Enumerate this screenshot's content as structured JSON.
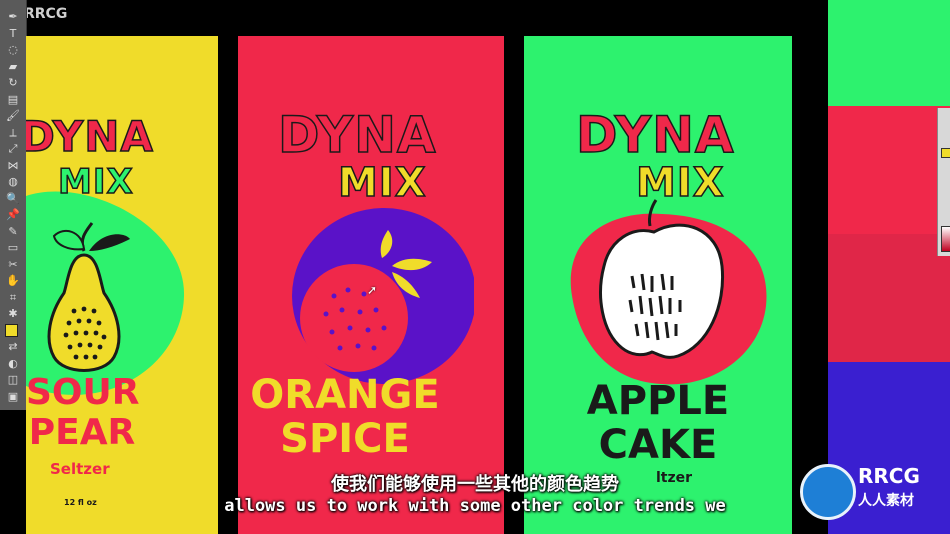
{
  "watermark": {
    "top_left": "RRCG",
    "logo_brand": "RRCG",
    "logo_subtitle": "人人素材"
  },
  "colors": {
    "yellow": "#f0dc2a",
    "red": "#f0284a",
    "green": "#2df26e",
    "purple": "#5a12c8",
    "blue": "#3a1fd0",
    "dark_red": "#b5163a"
  },
  "toolbar": {
    "tools": [
      "pen-icon",
      "type-icon",
      "lasso-icon",
      "eraser-icon",
      "rotate-icon",
      "gradient-icon",
      "brush-icon",
      "width-icon",
      "scale-icon",
      "blend-icon",
      "shape-builder-icon",
      "zoom-icon",
      "pin-icon",
      "eyedropper-icon",
      "artboard-icon",
      "slice-icon",
      "hand-icon",
      "mesh-icon",
      "symbol-icon",
      "fill-stroke-icon",
      "swap-icon",
      "color-mode-icon",
      "draw-mode-icon",
      "screen-mode-icon"
    ]
  },
  "cans": [
    {
      "brand_line1": "DYNA",
      "brand_line2": "MIX",
      "flavor_line1": "SOUR",
      "flavor_line2": "PEAR",
      "type": "Seltzer",
      "volume": "12 fl oz"
    },
    {
      "brand_line1": "DYNA",
      "brand_line2": "MIX",
      "flavor_line1": "ORANGE",
      "flavor_line2": "SPICE"
    },
    {
      "brand_line1": "DYNA",
      "brand_line2": "MIX",
      "flavor_line1": "APPLE",
      "flavor_line2": "CAKE",
      "type": "ltzer"
    }
  ],
  "subtitles": {
    "chinese": "使我们能够使用一些其他的颜色趋势",
    "english": "allows us to work with some other color trends we"
  }
}
